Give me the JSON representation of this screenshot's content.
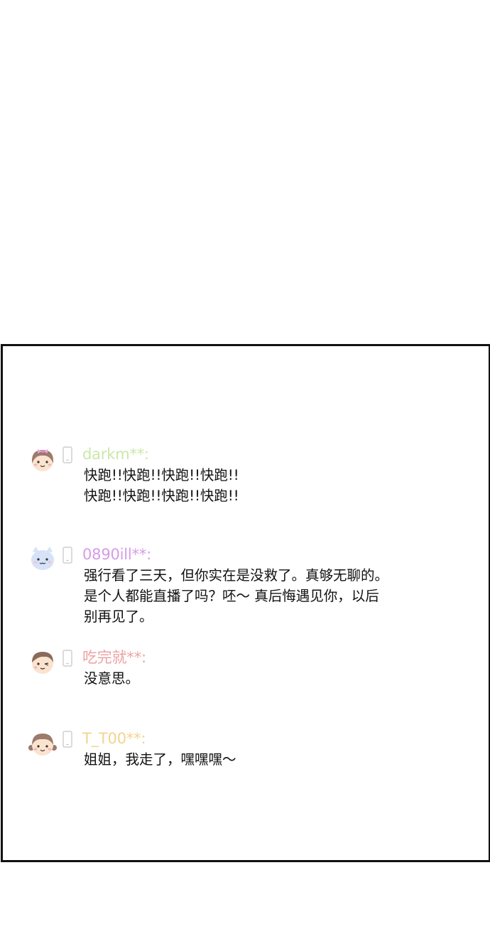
{
  "colors": {
    "panel_border": "#111111",
    "text": "#111111",
    "phone_icon": "#cfcfcf"
  },
  "comments": [
    {
      "username": "darkm**:",
      "user_color": "#cbe7a9",
      "avatar_icon": "girl-with-bow-avatar-icon",
      "device_icon": "phone-icon",
      "lines": [
        "快跑!!快跑!!快跑!!快跑!!",
        "快跑!!快跑!!快跑!!快跑!!"
      ]
    },
    {
      "username": "0890ill**:",
      "user_color": "#d69be8",
      "avatar_icon": "cat-avatar-icon",
      "device_icon": "phone-icon",
      "lines": [
        "强行看了三天，但你实在是没救了。真够无聊的。",
        "是个人都能直播了吗？呸～ 真后悔遇见你，以后",
        "别再见了。"
      ]
    },
    {
      "username": "吃完就**:",
      "user_color": "#eea3a3",
      "avatar_icon": "winking-boy-avatar-icon",
      "device_icon": "phone-icon",
      "lines": [
        "没意思。"
      ]
    },
    {
      "username": "T_T00**:",
      "user_color": "#f3d48f",
      "avatar_icon": "girl-with-pigtails-avatar-icon",
      "device_icon": "phone-icon",
      "lines": [
        "姐姐，我走了，嘿嘿嘿～"
      ]
    }
  ]
}
